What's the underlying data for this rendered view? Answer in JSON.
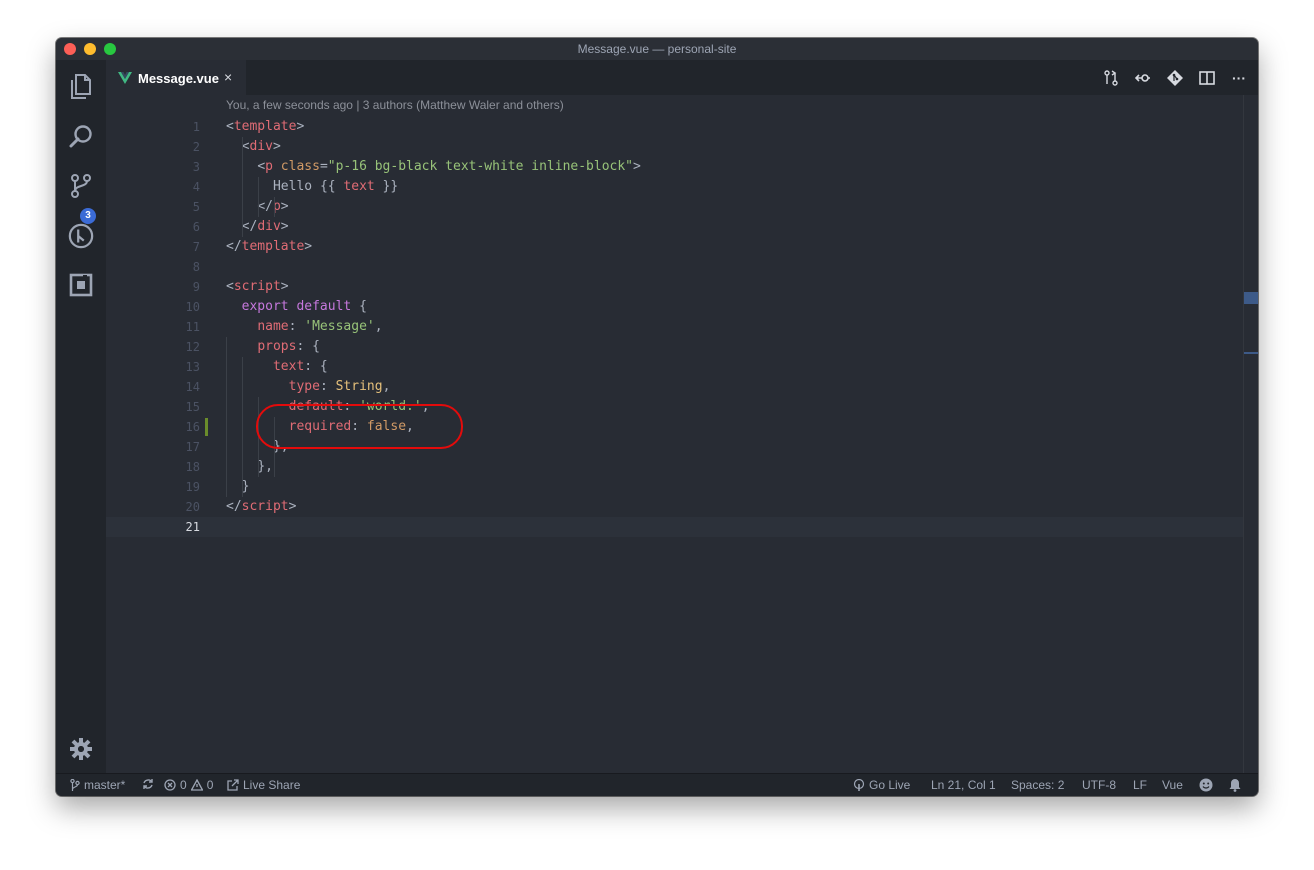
{
  "window": {
    "title": "Message.vue — personal-site"
  },
  "activity_bar": {
    "items": [
      {
        "name": "explorer-icon"
      },
      {
        "name": "search-icon"
      },
      {
        "name": "source-control-icon",
        "badge": "3"
      },
      {
        "name": "debug-icon"
      },
      {
        "name": "extensions-icon"
      },
      {
        "name": "gear-icon"
      }
    ]
  },
  "tab": {
    "label": "Message.vue",
    "close": "×",
    "icon": "vue-icon"
  },
  "toolbar": {
    "actions": [
      "compare-changes-icon",
      "open-changes-icon",
      "git-icon",
      "split-editor-icon",
      "more-icon"
    ],
    "more_label": "···"
  },
  "editor": {
    "blame": "You, a few seconds ago | 3 authors (Matthew Waler and others)",
    "line_numbers": [
      "1",
      "2",
      "3",
      "4",
      "5",
      "6",
      "7",
      "8",
      "9",
      "10",
      "11",
      "12",
      "13",
      "14",
      "15",
      "16",
      "17",
      "18",
      "19",
      "20",
      "21"
    ],
    "active_line": 21,
    "code": {
      "l1": {
        "open": "<",
        "tag": "template",
        "close": ">"
      },
      "l2": {
        "open": "<",
        "tag": "div",
        "close": ">"
      },
      "l3": {
        "open": "<",
        "tag": "p",
        "attr": "class",
        "eq": "=",
        "value": "\"p-16 bg-black text-white inline-block\"",
        "close": ">"
      },
      "l4": {
        "text": "Hello ",
        "open_mustache": "{{ ",
        "expr": "text",
        "close_mustache": " }}"
      },
      "l5": {
        "open": "</",
        "tag": "p",
        "close": ">"
      },
      "l6": {
        "open": "</",
        "tag": "div",
        "close": ">"
      },
      "l7": {
        "open": "</",
        "tag": "template",
        "close": ">"
      },
      "l9": {
        "open": "<",
        "tag": "script",
        "close": ">"
      },
      "l10": {
        "kw1": "export",
        "kw2": "default",
        "brace": " {"
      },
      "l11": {
        "key": "name",
        "colon": ": ",
        "value": "'Message'",
        "comma": ","
      },
      "l12": {
        "key": "props",
        "rest": ": {"
      },
      "l13": {
        "key": "text",
        "rest": ": {"
      },
      "l14": {
        "key": "type",
        "colon": ": ",
        "value": "String",
        "comma": ","
      },
      "l15": {
        "key": "default",
        "colon": ": ",
        "value": "'world.'",
        "comma": ","
      },
      "l16": {
        "key": "required",
        "colon": ": ",
        "value": "false",
        "comma": ","
      },
      "l17": {
        "text": "},"
      },
      "l18": {
        "text": "},"
      },
      "l19": {
        "text": "}"
      },
      "l20": {
        "open": "</",
        "tag": "script",
        "close": ">"
      }
    }
  },
  "status_bar": {
    "branch": "master*",
    "errors": "0",
    "warnings": "0",
    "live_share": "Live Share",
    "go_live": "Go Live",
    "position": "Ln 21, Col 1",
    "spaces": "Spaces: 2",
    "encoding": "UTF-8",
    "eol": "LF",
    "language": "Vue"
  },
  "colors": {
    "highlight_circle": "#e30b0b",
    "badge": "#3b6bd6",
    "gutter_modified": "#6a8c2b"
  }
}
